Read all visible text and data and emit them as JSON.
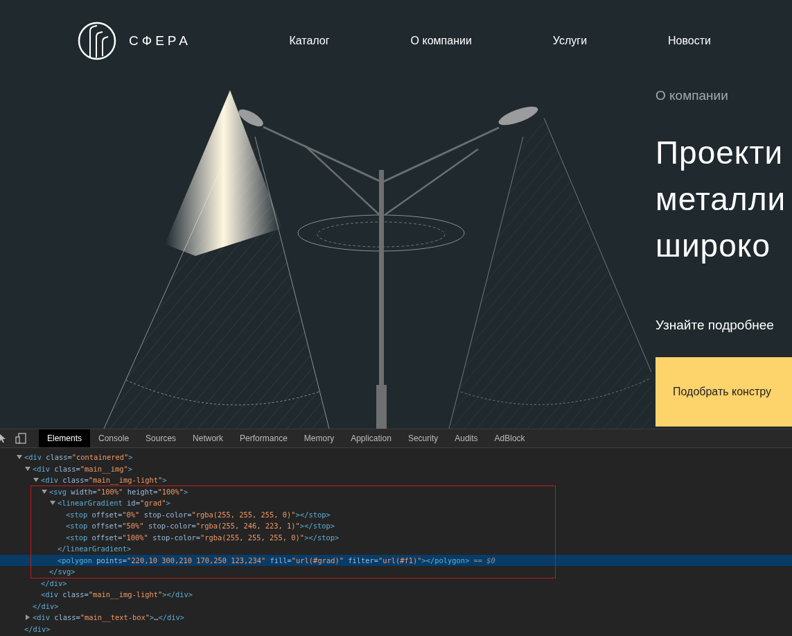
{
  "site": {
    "logo_text": "СФЕРА",
    "nav": [
      {
        "label": "Каталог"
      },
      {
        "label": "О компании"
      },
      {
        "label": "Услуги"
      },
      {
        "label": "Новости"
      }
    ],
    "hero": {
      "eyebrow": "О компании",
      "heading_lines": [
        "Проекти",
        "металли",
        "широко"
      ],
      "subtitle": "Узнайте подробнее",
      "cta": "Подобрать констру"
    }
  },
  "devtools": {
    "tabs": [
      {
        "label": "Elements",
        "selected": true
      },
      {
        "label": "Console",
        "selected": false
      },
      {
        "label": "Sources",
        "selected": false
      },
      {
        "label": "Network",
        "selected": false
      },
      {
        "label": "Performance",
        "selected": false
      },
      {
        "label": "Memory",
        "selected": false
      },
      {
        "label": "Application",
        "selected": false
      },
      {
        "label": "Security",
        "selected": false
      },
      {
        "label": "Audits",
        "selected": false
      },
      {
        "label": "AdBlock",
        "selected": false
      }
    ],
    "selected_marker": "== $0",
    "tree": [
      {
        "text": "<div class=\"containered\">",
        "expanded": true,
        "selected": false,
        "close": "</div>",
        "children": [
          {
            "text": "<div class=\"main__img\">",
            "expanded": true,
            "selected": false,
            "close": "</div>",
            "children": [
              {
                "text": "<div class=\"main__img-light\">",
                "expanded": true,
                "selected": false,
                "close": "</div>",
                "children": [
                  {
                    "text": "<svg width=\"100%\" height=\"100%\">",
                    "expanded": true,
                    "selected": false,
                    "highlighted": true,
                    "close": "</svg>",
                    "children": [
                      {
                        "text": "<linearGradient id=\"grad\">",
                        "expanded": true,
                        "selected": false,
                        "close": "</linearGradient>",
                        "children": [
                          {
                            "text": "<stop offset=\"0%\" stop-color=\"rgba(255, 255, 255, 0)\"></stop>",
                            "selected": false
                          },
                          {
                            "text": "<stop offset=\"50%\" stop-color=\"rgba(255, 246, 223, 1)\"></stop>",
                            "selected": false
                          },
                          {
                            "text": "<stop offset=\"100%\" stop-color=\"rgba(255, 255, 255, 0)\"></stop>",
                            "selected": false
                          }
                        ]
                      },
                      {
                        "text": "<polygon points=\"220,10 300,210 170,250 123,234\" fill=\"url(#grad)\" filter=\"url(#f1)\"></polygon>",
                        "selected": true
                      }
                    ]
                  }
                ]
              },
              {
                "text": "<div class=\"main__img-light\"></div>",
                "selected": false
              }
            ]
          },
          {
            "text": "<div class=\"main__text-box\">…</div>",
            "expanded": false,
            "selected": false
          }
        ]
      }
    ]
  }
}
